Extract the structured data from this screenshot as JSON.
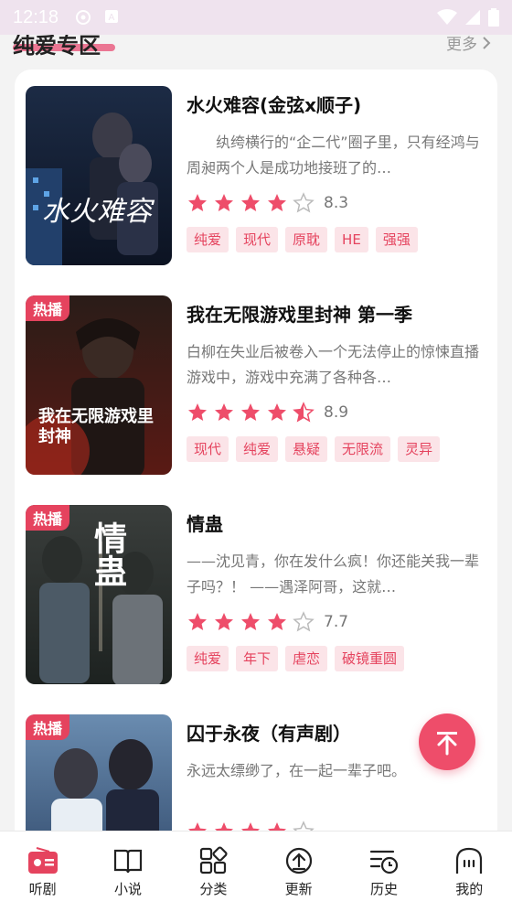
{
  "status_bar": {
    "time": "12:18"
  },
  "section": {
    "title": "纯爱专区",
    "more": "更多"
  },
  "items": [
    {
      "title": "水火难容(金弦x顺子)",
      "hot_badge": "",
      "description": "纨绔横行的“企二代”圈子里，只有经鸿与周昶两个人是成功地接班了的…",
      "rating": 8.3,
      "stars_filled": 4,
      "score": "8.3",
      "tags": [
        "纯爱",
        "现代",
        "原耽",
        "HE",
        "强强"
      ],
      "cover_text": "水火难容"
    },
    {
      "title": "我在无限游戏里封神 第一季",
      "hot_badge": "热播",
      "description": "白柳在失业后被卷入一个无法停止的惊悚直播游戏中，游戏中充满了各种各…",
      "rating": 8.9,
      "stars_filled": 4.5,
      "score": "8.9",
      "tags": [
        "现代",
        "纯爱",
        "悬疑",
        "无限流",
        "灵异"
      ],
      "cover_text": "我在无限游戏里封神"
    },
    {
      "title": "情蛊",
      "hot_badge": "热播",
      "description": "——沈见青，你在发什么疯！你还能关我一辈子吗？！ ——遇泽阿哥，这就…",
      "rating": 7.7,
      "stars_filled": 4,
      "score": "7.7",
      "tags": [
        "纯爱",
        "年下",
        "虐恋",
        "破镜重圆"
      ],
      "cover_text": "情蛊"
    },
    {
      "title": "囚于永夜（有声剧）",
      "hot_badge": "热播",
      "description": "永远太缥缈了，在一起一辈子吧。",
      "rating": null,
      "stars_filled": 4,
      "score": "",
      "tags": [],
      "cover_text": ""
    }
  ],
  "bottom_nav": [
    {
      "label": "听剧",
      "icon": "radio-icon",
      "active": true
    },
    {
      "label": "小说",
      "icon": "book-icon",
      "active": false
    },
    {
      "label": "分类",
      "icon": "category-icon",
      "active": false
    },
    {
      "label": "更新",
      "icon": "update-icon",
      "active": false
    },
    {
      "label": "历史",
      "icon": "history-icon",
      "active": false
    },
    {
      "label": "我的",
      "icon": "profile-icon",
      "active": false
    }
  ],
  "colors": {
    "accent": "#e5435e",
    "star": "#ee4d6a",
    "tag_bg": "#fbe4e8"
  }
}
